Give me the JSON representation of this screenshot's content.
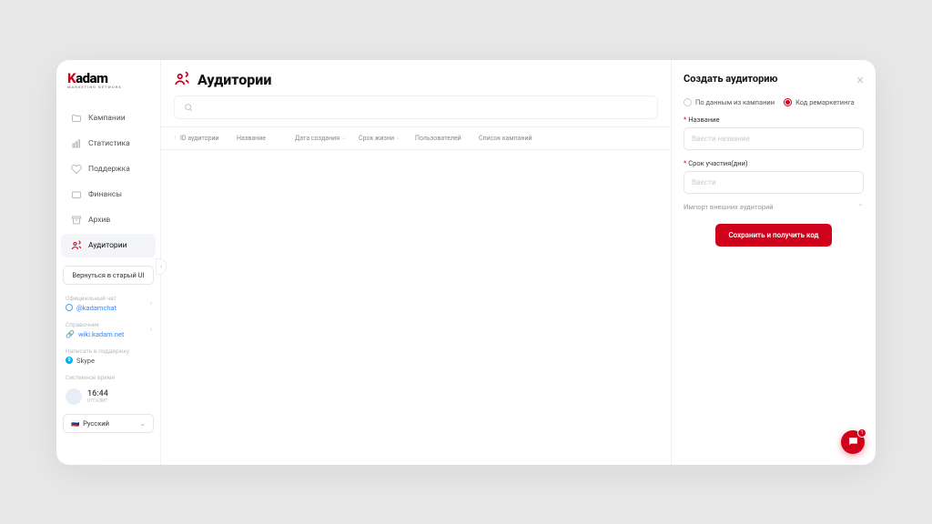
{
  "logo": {
    "brand_a": "K",
    "brand_b": "adam",
    "sub": "MARKETING NETWORK"
  },
  "sidebar": {
    "items": [
      {
        "label": "Кампании"
      },
      {
        "label": "Статистика"
      },
      {
        "label": "Поддержка"
      },
      {
        "label": "Финансы"
      },
      {
        "label": "Архив"
      },
      {
        "label": "Аудитории"
      }
    ],
    "old_ui": "Вернуться в старый UI",
    "chat": {
      "title": "Официальный чат",
      "value": "@kadamchat"
    },
    "docs": {
      "title": "Справочник",
      "value": "wiki.kadam.net"
    },
    "support": {
      "title": "Написать в поддержку",
      "value": "Skype"
    },
    "time": {
      "title": "Системное время",
      "value": "16:44",
      "sub": "UTC+0MT"
    },
    "lang": {
      "flag": "🇷🇺",
      "value": "Русский"
    }
  },
  "page": {
    "title": "Аудитории",
    "columns": [
      "ID аудитории",
      "Название",
      "Дата создания",
      "Срок жизни",
      "Пользователей",
      "Список кампаний"
    ]
  },
  "panel": {
    "title": "Создать аудиторию",
    "radio1": "По данным из кампании",
    "radio2": "Код ремаркетинга",
    "name_label": "Название",
    "name_ph": "Ввести название",
    "term_label": "Срок участия(дни)",
    "term_ph": "Ввести",
    "import": "Импорт внешних аудиторий",
    "save": "Сохранить и получить код"
  },
  "chat_count": "1"
}
